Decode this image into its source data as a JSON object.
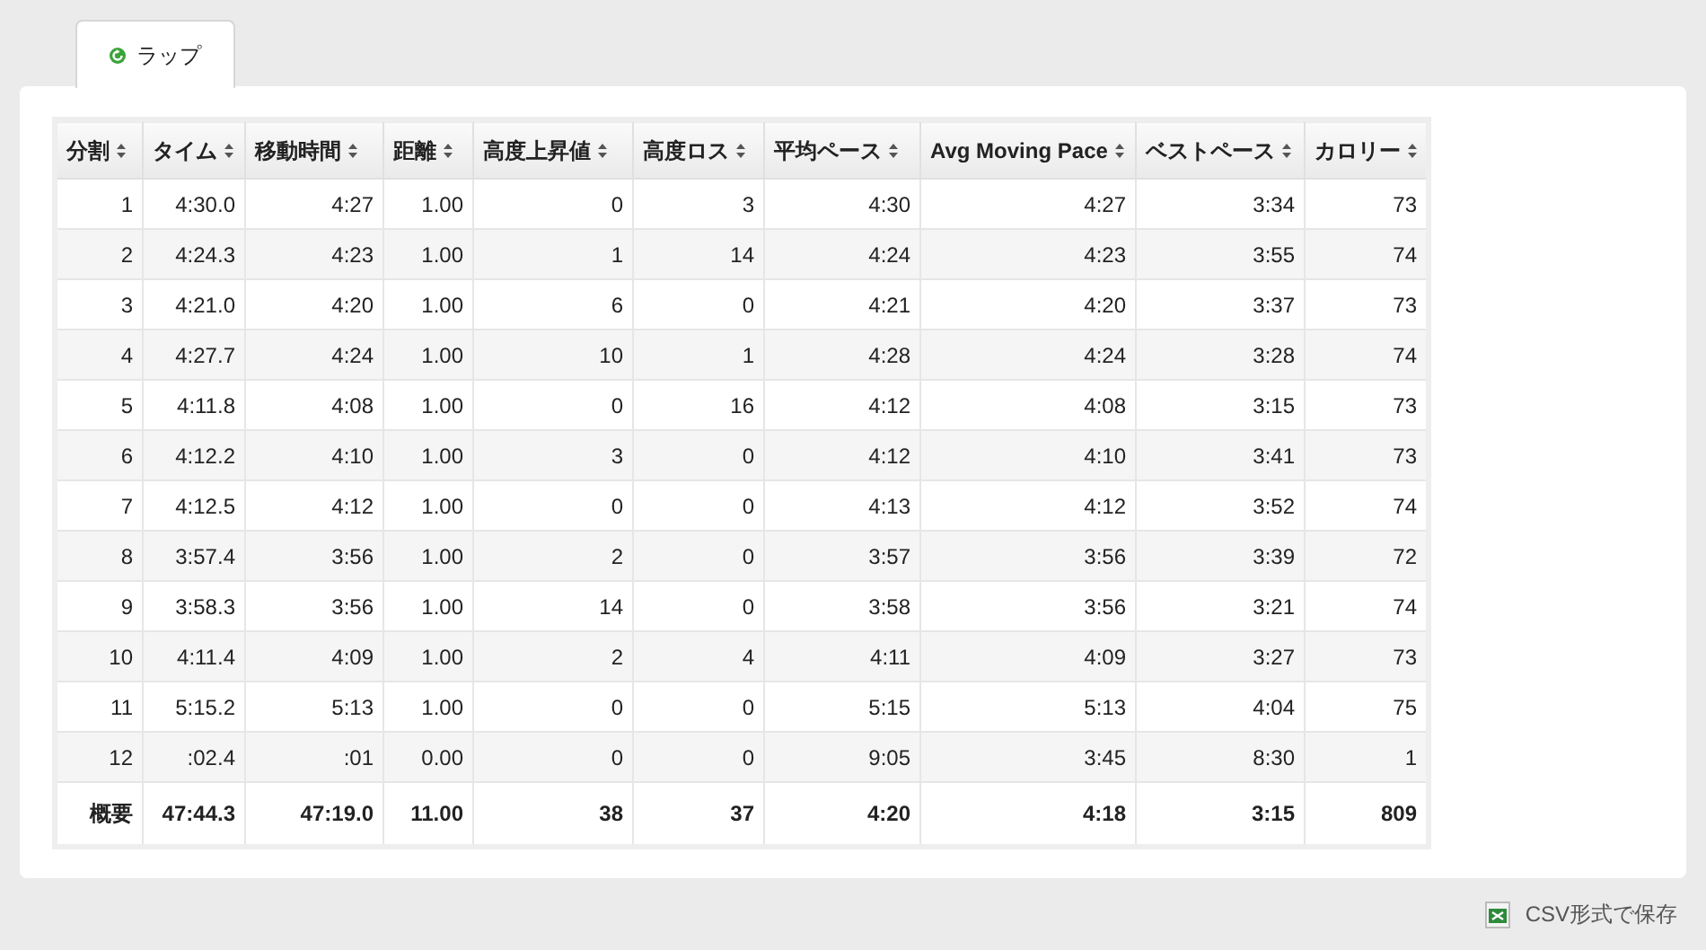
{
  "tabs": [
    {
      "label": "ラップ",
      "selected": true
    }
  ],
  "table": {
    "columns": [
      "分割",
      "タイム",
      "移動時間",
      "距離",
      "高度上昇値",
      "高度ロス",
      "平均ペース",
      "Avg Moving Pace",
      "ベストペース",
      "カロリー"
    ],
    "rows": [
      [
        "1",
        "4:30.0",
        "4:27",
        "1.00",
        "0",
        "3",
        "4:30",
        "4:27",
        "3:34",
        "73"
      ],
      [
        "2",
        "4:24.3",
        "4:23",
        "1.00",
        "1",
        "14",
        "4:24",
        "4:23",
        "3:55",
        "74"
      ],
      [
        "3",
        "4:21.0",
        "4:20",
        "1.00",
        "6",
        "0",
        "4:21",
        "4:20",
        "3:37",
        "73"
      ],
      [
        "4",
        "4:27.7",
        "4:24",
        "1.00",
        "10",
        "1",
        "4:28",
        "4:24",
        "3:28",
        "74"
      ],
      [
        "5",
        "4:11.8",
        "4:08",
        "1.00",
        "0",
        "16",
        "4:12",
        "4:08",
        "3:15",
        "73"
      ],
      [
        "6",
        "4:12.2",
        "4:10",
        "1.00",
        "3",
        "0",
        "4:12",
        "4:10",
        "3:41",
        "73"
      ],
      [
        "7",
        "4:12.5",
        "4:12",
        "1.00",
        "0",
        "0",
        "4:13",
        "4:12",
        "3:52",
        "74"
      ],
      [
        "8",
        "3:57.4",
        "3:56",
        "1.00",
        "2",
        "0",
        "3:57",
        "3:56",
        "3:39",
        "72"
      ],
      [
        "9",
        "3:58.3",
        "3:56",
        "1.00",
        "14",
        "0",
        "3:58",
        "3:56",
        "3:21",
        "74"
      ],
      [
        "10",
        "4:11.4",
        "4:09",
        "1.00",
        "2",
        "4",
        "4:11",
        "4:09",
        "3:27",
        "73"
      ],
      [
        "11",
        "5:15.2",
        "5:13",
        "1.00",
        "0",
        "0",
        "5:15",
        "5:13",
        "4:04",
        "75"
      ],
      [
        "12",
        ":02.4",
        ":01",
        "0.00",
        "0",
        "0",
        "9:05",
        "3:45",
        "8:30",
        "1"
      ]
    ],
    "summary": [
      "概要",
      "47:44.3",
      "47:19.0",
      "11.00",
      "38",
      "37",
      "4:20",
      "4:18",
      "3:15",
      "809"
    ]
  },
  "export_link": "CSV形式で保存"
}
